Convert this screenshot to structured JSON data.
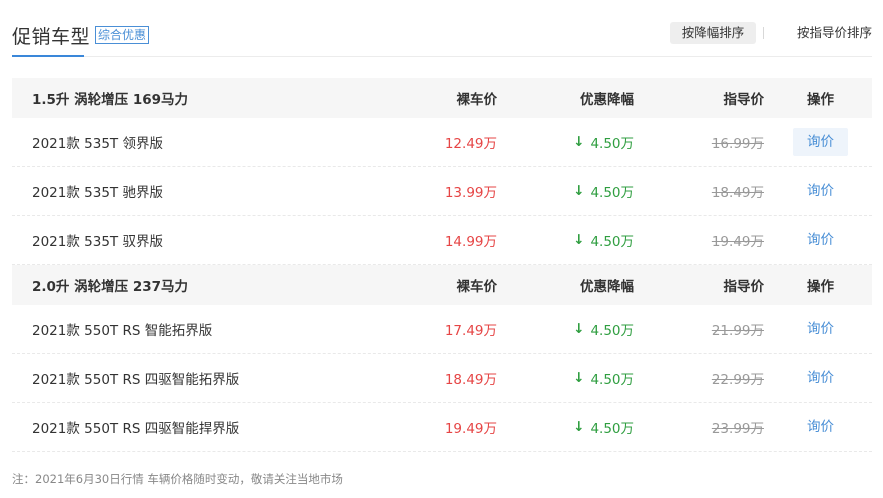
{
  "header": {
    "title": "促销车型",
    "tag": "综合优惠",
    "sort_by_discount": "按降幅排序",
    "sort_by_guide": "按指导价排序"
  },
  "columns": {
    "price": "裸车价",
    "discount": "优惠降幅",
    "guide": "指导价",
    "op": "操作"
  },
  "groups": [
    {
      "name": "1.5升 涡轮增压 169马力",
      "rows": [
        {
          "name": "2021款 535T 领界版",
          "price": "12.49万",
          "discount": "4.50万",
          "guide": "16.99万",
          "op": "询价"
        },
        {
          "name": "2021款 535T 驰界版",
          "price": "13.99万",
          "discount": "4.50万",
          "guide": "18.49万",
          "op": "询价"
        },
        {
          "name": "2021款 535T 驭界版",
          "price": "14.99万",
          "discount": "4.50万",
          "guide": "19.49万",
          "op": "询价"
        }
      ]
    },
    {
      "name": "2.0升 涡轮增压 237马力",
      "rows": [
        {
          "name": "2021款 550T RS 智能拓界版",
          "price": "17.49万",
          "discount": "4.50万",
          "guide": "21.99万",
          "op": "询价"
        },
        {
          "name": "2021款 550T RS 四驱智能拓界版",
          "price": "18.49万",
          "discount": "4.50万",
          "guide": "22.99万",
          "op": "询价"
        },
        {
          "name": "2021款 550T RS 四驱智能捍界版",
          "price": "19.49万",
          "discount": "4.50万",
          "guide": "23.99万",
          "op": "询价"
        }
      ]
    }
  ],
  "discount_arrow": "↓",
  "colors": {
    "accent": "#4a8fd6",
    "price": "#e64545",
    "discount": "#2f9e40",
    "guide": "#999999"
  },
  "footnote": "注：2021年6月30日行情 车辆价格随时变动，敬请关注当地市场"
}
